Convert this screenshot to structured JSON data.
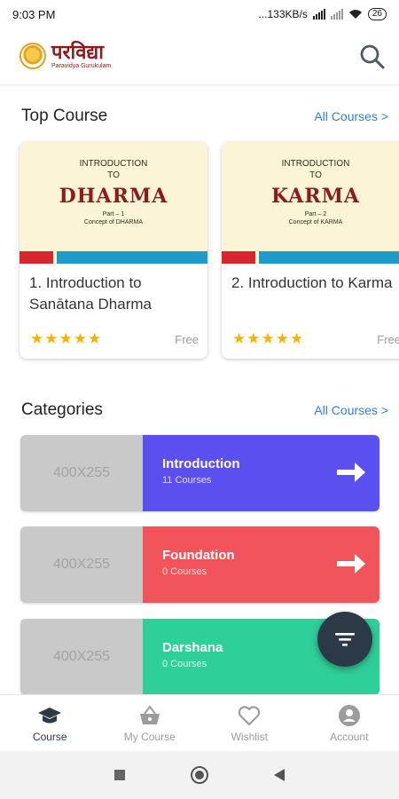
{
  "status_bar": {
    "time": "9:03 PM",
    "network_speed": "...133KB/s",
    "battery": "26"
  },
  "app": {
    "logo_title": "परविद्या",
    "logo_subtitle": "Paravidya Gurukulam"
  },
  "top_course": {
    "title": "Top Course",
    "link": "All Courses >",
    "courses": [
      {
        "cover_intro": "INTRODUCTION\nTO",
        "cover_big": "DHARMA",
        "cover_small": "Part – 1\nConcept of DHARMA",
        "title": "1. Introduction to Sanātana Dharma",
        "rating": 5,
        "stars": "★★★★★",
        "price": "Free"
      },
      {
        "cover_intro": "INTRODUCTION\nTO",
        "cover_big": "KARMA",
        "cover_small": "Part – 2\nConcept of KARMA",
        "title": "2. Introduction to Karma",
        "rating": 5,
        "stars": "★★★★★",
        "price": "Free"
      }
    ]
  },
  "categories": {
    "title": "Categories",
    "link": "All Courses >",
    "items": [
      {
        "image_placeholder": "400X255",
        "name": "Introduction",
        "count": "11 Courses",
        "color": "#5b4ff0"
      },
      {
        "image_placeholder": "400X255",
        "name": "Foundation",
        "count": "0 Courses",
        "color": "#f2545b"
      },
      {
        "image_placeholder": "400X255",
        "name": "Darshana",
        "count": "0 Courses",
        "color": "#2fcf9a"
      }
    ]
  },
  "bottom_nav": {
    "items": [
      {
        "label": "Course",
        "icon": "graduation-cap-icon",
        "active": true
      },
      {
        "label": "My Course",
        "icon": "basket-icon",
        "active": false
      },
      {
        "label": "Wishlist",
        "icon": "heart-icon",
        "active": false
      },
      {
        "label": "Account",
        "icon": "account-icon",
        "active": false
      }
    ]
  },
  "colors": {
    "accent_link": "#2f7fd0",
    "brand": "#8c1c1c",
    "nav_active": "#2c3a47",
    "fab": "#2c3a47",
    "star": "#f5b301"
  }
}
